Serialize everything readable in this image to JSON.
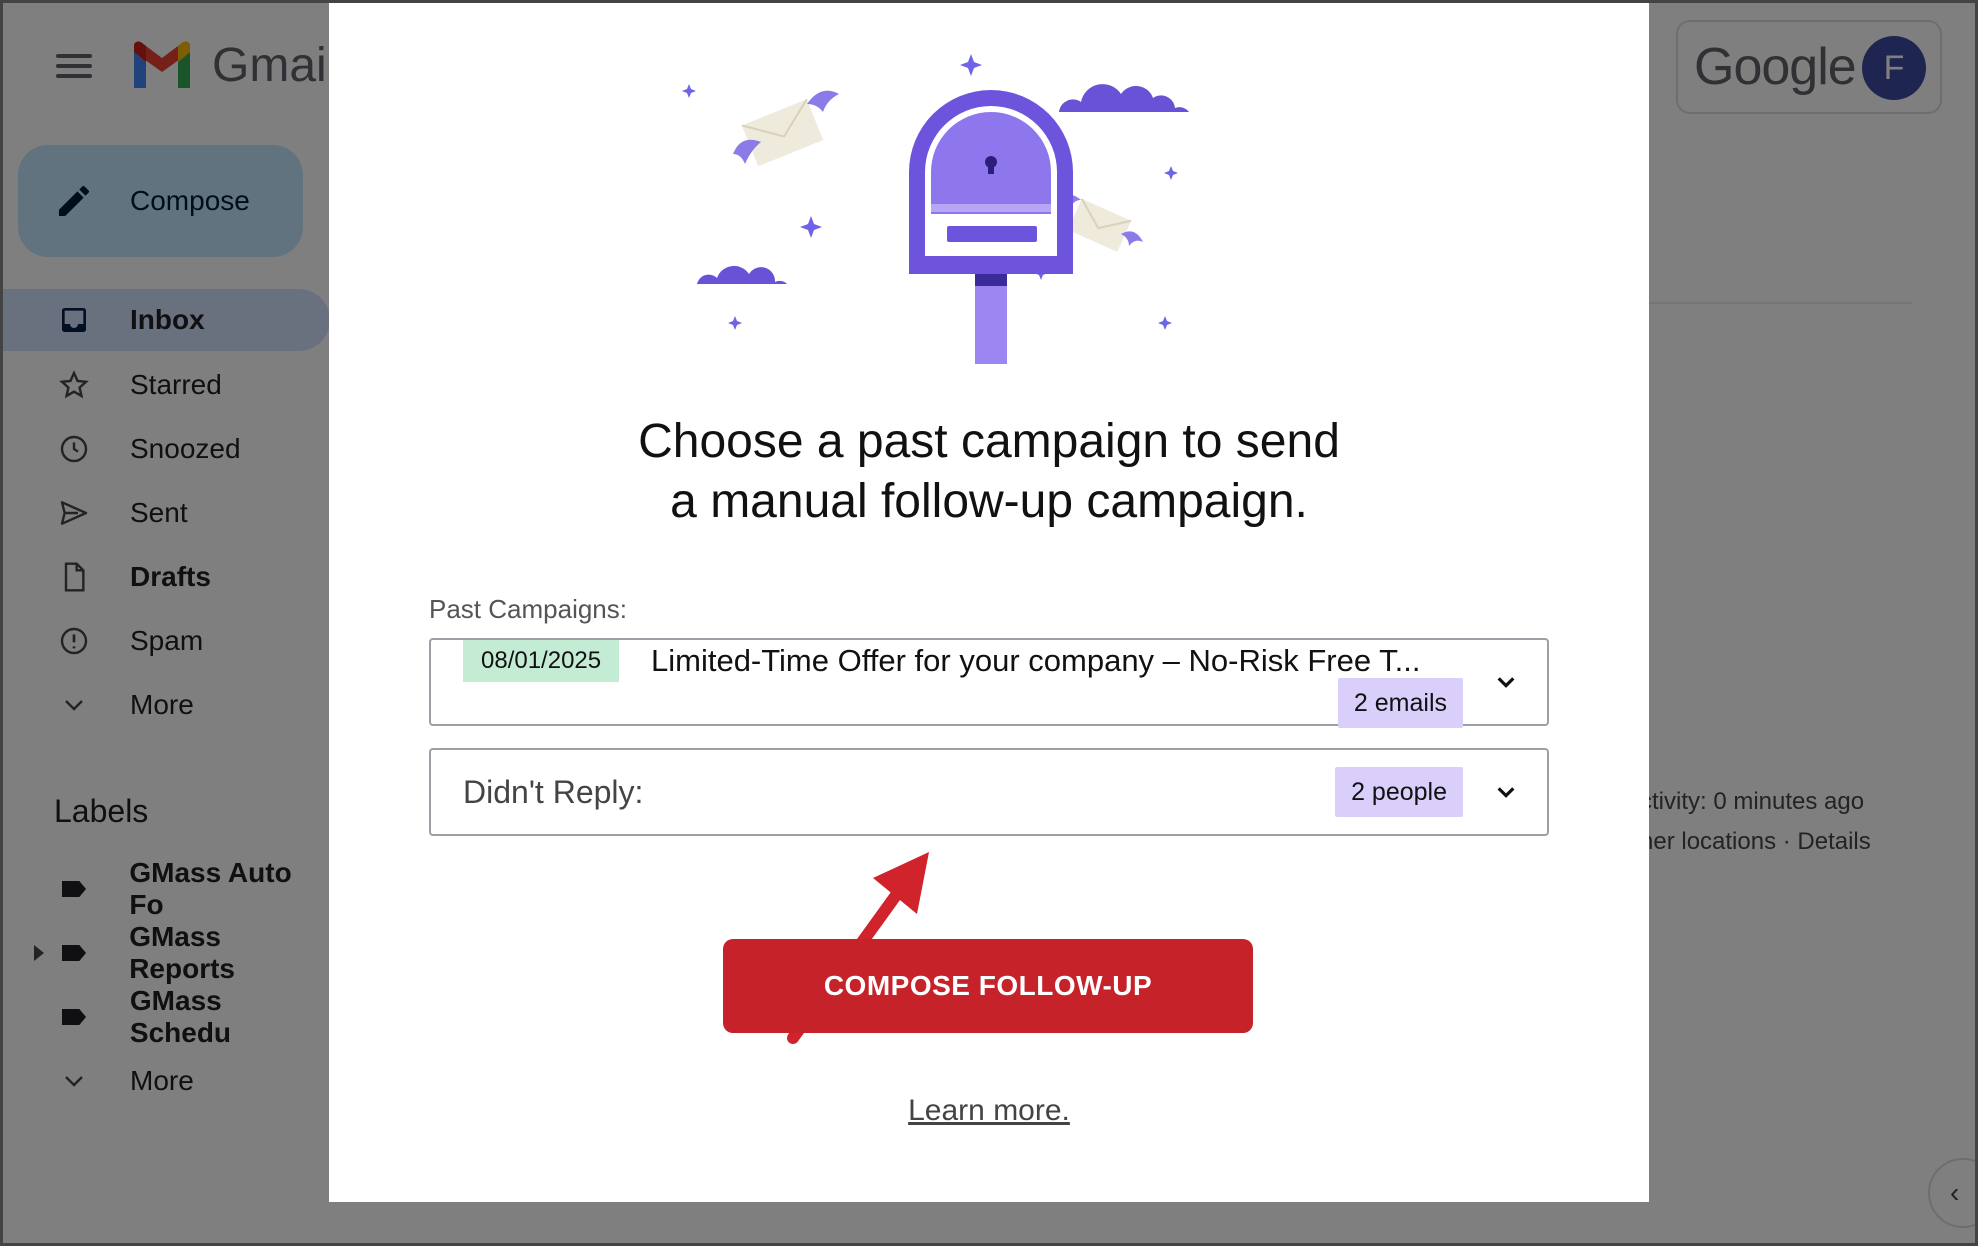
{
  "gmail": {
    "app_name": "Gmail",
    "compose_label": "Compose",
    "nav": [
      {
        "label": "Inbox"
      },
      {
        "label": "Starred"
      },
      {
        "label": "Snoozed"
      },
      {
        "label": "Sent"
      },
      {
        "label": "Drafts"
      },
      {
        "label": "Spam"
      },
      {
        "label": "More"
      }
    ],
    "labels_heading": "Labels",
    "labels": [
      {
        "label": "GMass Auto Fo"
      },
      {
        "label": "GMass Reports"
      },
      {
        "label": "GMass Schedu"
      },
      {
        "label": "More"
      }
    ],
    "account": {
      "brand": "Google",
      "avatar_letter": "F"
    },
    "activity_line1": "ctivity: 0 minutes ago",
    "activity_line2": "her locations · Details"
  },
  "modal": {
    "headline_line1": "Choose a past campaign to send",
    "headline_line2": "a manual follow-up campaign.",
    "past_campaigns_label": "Past Campaigns:",
    "campaign": {
      "date": "08/01/2025",
      "title": "Limited-Time Offer for your company – No-Risk Free T...",
      "count": "2 emails"
    },
    "filter": {
      "label": "Didn't Reply:",
      "count": "2 people"
    },
    "cta_label": "COMPOSE FOLLOW-UP",
    "learn_more": "Learn more."
  },
  "colors": {
    "cta": "#c5222a",
    "date_badge": "#c4ecd5",
    "count_badge": "#d9cffa",
    "illustration_purple": "#7b5ee0",
    "annotation_arrow": "#d0232b"
  }
}
